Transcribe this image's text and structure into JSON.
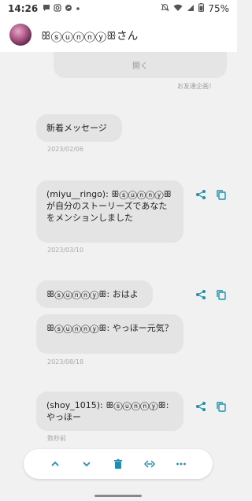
{
  "status_bar": {
    "time": "14:26",
    "battery": "75%",
    "left_icons": [
      "chat-icon",
      "instagram-icon",
      "messenger-icon",
      "dot-icon"
    ],
    "right_icons": [
      "mute-icon",
      "wifi-icon",
      "signal-icon",
      "battery-icon"
    ]
  },
  "header": {
    "title": "ꕥⓢⓤⓝⓝⓨꕥさん"
  },
  "top_card": {
    "button_label": "開く",
    "note": "お友達企画！"
  },
  "messages": [
    {
      "text": "新着メッセージ",
      "date": "2023/02/06",
      "actions": false
    },
    {
      "text": "(miyu__ringo): ꕥⓢⓤⓝⓝⓨꕥが自分のストーリーズであなたをメンションしました",
      "date": "2023/03/10",
      "actions": true
    },
    {
      "text": "ꕥⓢⓤⓝⓝⓨꕥ: おはよ",
      "date": "",
      "actions": true
    },
    {
      "text": "ꕥⓢⓤⓝⓝⓨꕥ: やっほー元気？",
      "date": "2023/08/18",
      "actions": false
    },
    {
      "text": "(shoy_1015): ꕥⓢⓤⓝⓝⓨꕥ: やっほー",
      "date": "数秒前",
      "actions": true
    }
  ],
  "toolbar": {
    "buttons": [
      "chevron-up-icon",
      "chevron-down-icon",
      "trash-icon",
      "exit-icon",
      "more-icon"
    ]
  },
  "colors": {
    "accent": "#1d8fb0",
    "bubble": "#e4e4e4",
    "background": "#f1f1f1"
  }
}
